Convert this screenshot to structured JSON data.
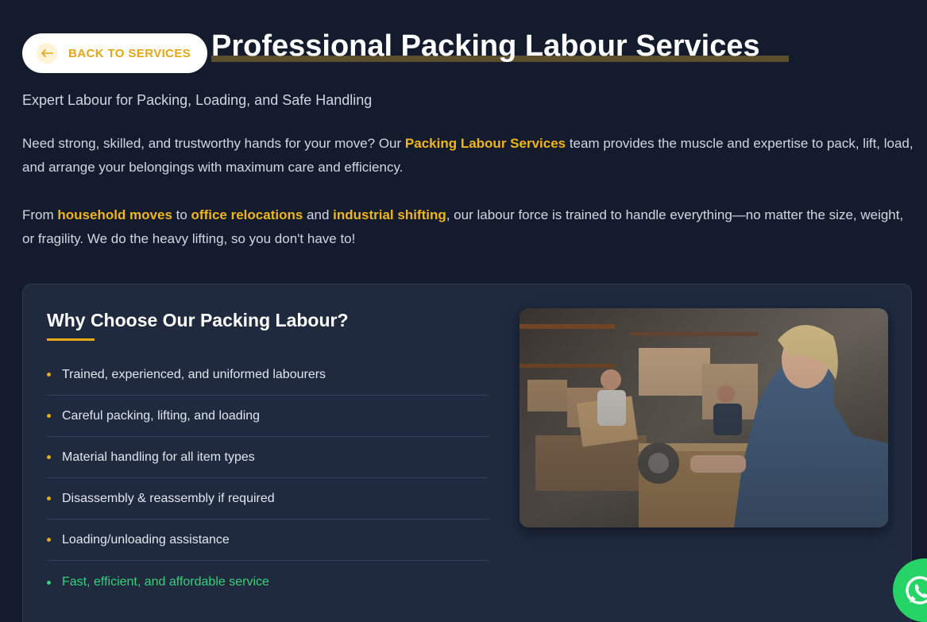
{
  "nav": {
    "back_label": "BACK TO SERVICES"
  },
  "header": {
    "title": "Professional Packing Labour Services",
    "subtitle": "Expert Labour for Packing, Loading, and Safe Handling"
  },
  "intro": {
    "p1": {
      "before": "Need strong, skilled, and trustworthy hands for your move? Our ",
      "highlight": "Packing Labour Services",
      "after": " team provides the muscle and expertise to pack, lift, load, and arrange your belongings with maximum care and efficiency."
    },
    "p2": {
      "t1": "From ",
      "h1": "household moves",
      "t2": " to ",
      "h2": "office relocations",
      "t3": " and ",
      "h3": "industrial shifting",
      "t4": ", our labour force is trained to handle everything—no matter the size, weight, or fragility. We do the heavy lifting, so you don't have to!"
    }
  },
  "why": {
    "heading": "Why Choose Our Packing Labour?",
    "items": [
      "Trained, experienced, and uniformed labourers",
      "Careful packing, lifting, and loading",
      "Material handling for all item types",
      "Disassembly & reassembly if required",
      "Loading/unloading assistance",
      "Fast, efficient, and affordable service"
    ]
  },
  "colors": {
    "background": "#131b2d",
    "accent": "#f0b51d",
    "card": "#1f2a3f",
    "success": "#36d17a",
    "whatsapp": "#25d366"
  },
  "icons": {
    "back": "arrow-left-icon",
    "bullet": "bullet-dot-icon",
    "whatsapp": "whatsapp-icon"
  }
}
